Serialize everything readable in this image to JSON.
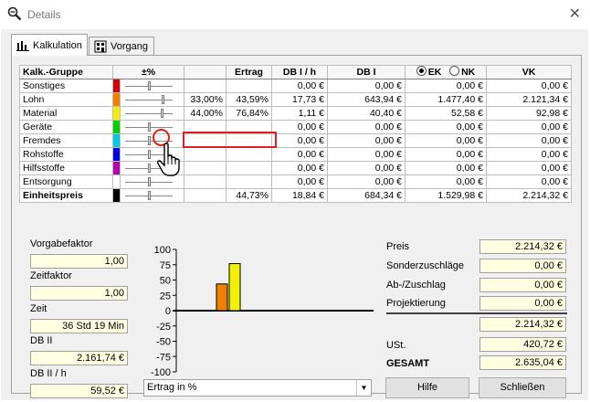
{
  "window": {
    "title": "Details",
    "close_glyph": "✕"
  },
  "tabs": [
    {
      "label": "Kalkulation",
      "icon": "bar-chart-icon",
      "active": true
    },
    {
      "label": "Vorgang",
      "icon": "building-icon",
      "active": false
    }
  ],
  "table": {
    "headers": {
      "group": "Kalk.-Gruppe",
      "pct": "±%",
      "ertrag": "Ertrag",
      "dbh": "DB I / h",
      "db": "DB I",
      "ek": "EK",
      "nk": "NK",
      "vk": "VK"
    },
    "selected_basis": "EK",
    "rows": [
      {
        "name": "Sonstiges",
        "color": "#d00000",
        "slider": 0.5,
        "pct": "",
        "ertrag": "",
        "dbh": "0,00 €",
        "db": "0,00 €",
        "eknk": "0,00 €",
        "vk": "0,00 €"
      },
      {
        "name": "Lohn",
        "color": "#f08000",
        "slider": 0.82,
        "pct": "33,00%",
        "ertrag": "43,59%",
        "dbh": "17,73 €",
        "db": "643,94 €",
        "eknk": "1.477,40 €",
        "vk": "2.121,34 €"
      },
      {
        "name": "Material",
        "color": "#f0f000",
        "slider": 0.8,
        "pct": "44,00%",
        "ertrag": "76,84%",
        "dbh": "1,11 €",
        "db": "40,40 €",
        "eknk": "52,58 €",
        "vk": "92,98 €"
      },
      {
        "name": "Geräte",
        "color": "#00d000",
        "slider": 0.5,
        "pct": "",
        "ertrag": "",
        "dbh": "0,00 €",
        "db": "0,00 €",
        "eknk": "0,00 €",
        "vk": "0,00 €"
      },
      {
        "name": "Fremdes",
        "color": "#00c8e0",
        "slider": 0.5,
        "pct": "",
        "ertrag": "",
        "dbh": "0,00 €",
        "db": "0,00 €",
        "eknk": "0,00 €",
        "vk": "0,00 €"
      },
      {
        "name": "Rohstoffe",
        "color": "#0000e0",
        "slider": 0.5,
        "pct": "",
        "ertrag": "",
        "dbh": "0,00 €",
        "db": "0,00 €",
        "eknk": "0,00 €",
        "vk": "0,00 €"
      },
      {
        "name": "Hilfsstoffe",
        "color": "#b000b0",
        "slider": 0.5,
        "pct": "",
        "ertrag": "",
        "dbh": "0,00 €",
        "db": "0,00 €",
        "eknk": "0,00 €",
        "vk": "0,00 €"
      },
      {
        "name": "Entsorgung",
        "color": "#ffffff",
        "slider": 0.5,
        "pct": "",
        "ertrag": "",
        "dbh": "0,00 €",
        "db": "0,00 €",
        "eknk": "0,00 €",
        "vk": "0,00 €"
      }
    ],
    "total": {
      "name": "Einheitspreis",
      "color": "#000000",
      "slider": 0.5,
      "pct": "",
      "ertrag": "44,73%",
      "dbh": "18,84 €",
      "db": "684,34 €",
      "eknk": "1.529,98 €",
      "vk": "2.214,32 €"
    }
  },
  "left_fields": {
    "vorgabefaktor_label": "Vorgabefaktor",
    "vorgabefaktor_value": "1,00",
    "zeitfaktor_label": "Zeitfaktor",
    "zeitfaktor_value": "1,00",
    "zeit_label": "Zeit",
    "zeit_value": "36 Std 19 Min",
    "db2_label": "DB II",
    "db2_value": "2.161,74 €",
    "db2h_label": "DB II / h",
    "db2h_value": "59,52 €"
  },
  "chart_data": {
    "type": "bar",
    "categories": [
      "Sonstiges",
      "Lohn",
      "Material",
      "Geräte",
      "Fremdes",
      "Rohstoffe",
      "Hilfsstoffe",
      "Entsorgung"
    ],
    "values": [
      0,
      43.59,
      76.84,
      0,
      0,
      0,
      0,
      0
    ],
    "colors": [
      "#d00000",
      "#f08000",
      "#f0f000",
      "#00d000",
      "#00c8e0",
      "#0000e0",
      "#b000b0",
      "#ffffff"
    ],
    "ylim": [
      -100,
      100
    ],
    "yticks": [
      "100",
      "75",
      "50",
      "25",
      "0",
      "-25",
      "-50",
      "-75",
      "-100"
    ],
    "ytick_values": [
      100,
      75,
      50,
      25,
      0,
      -25,
      -50,
      -75,
      -100
    ]
  },
  "chart_selector": {
    "value": "Ertrag in %"
  },
  "right_fields": {
    "preis_label": "Preis",
    "preis_value": "2.214,32 €",
    "sonder_label": "Sonderzuschläge",
    "sonder_value": "0,00 €",
    "abzu_label": "Ab-/Zuschlag",
    "abzu_value": "0,00 €",
    "proj_label": "Projektierung",
    "proj_value": "0,00 €",
    "subtotal_value": "2.214,32 €",
    "ust_label": "USt.",
    "ust_value": "420,72 €",
    "gesamt_label": "GESAMT",
    "gesamt_value": "2.635,04 €"
  },
  "buttons": {
    "hilfe": "Hilfe",
    "schliessen": "Schließen"
  }
}
